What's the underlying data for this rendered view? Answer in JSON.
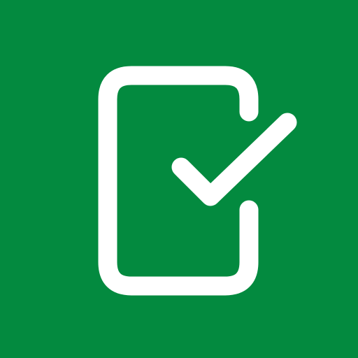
{
  "icon": {
    "name": "checklist-app-icon",
    "glyph": "clipboard-check-icon",
    "colors": {
      "background": "#038A3F",
      "foreground": "#FFFFFF"
    }
  }
}
